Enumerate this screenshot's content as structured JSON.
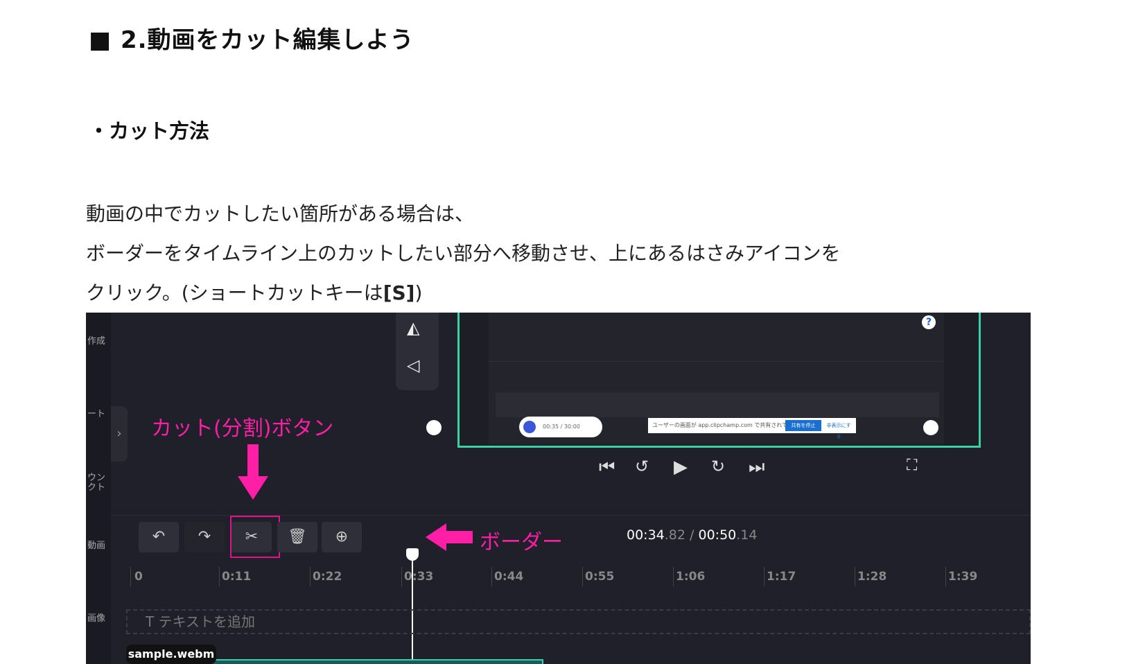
{
  "heading": "■ 2.動画をカット編集しよう",
  "subheading": "・カット方法",
  "paragraph": {
    "line1": "動画の中でカットしたい箇所がある場合は、",
    "line2": "ボーダーをタイムライン上のカットしたい部分へ移動させ、上にあるはさみアイコンを",
    "line3_prefix": "クリック。(ショートカットキーは",
    "line3_key": "[S]",
    "line3_suffix": ")"
  },
  "screenshot": {
    "left_rail_labels": [
      "作成",
      "ート",
      "ウン\nクト",
      "動画",
      "画像"
    ],
    "annotations": {
      "cut_button": "カット(分割)ボタン",
      "border": "ボーダー"
    },
    "toolbar_icons": [
      "undo-icon",
      "redo-icon",
      "scissors-icon",
      "trash-icon",
      "add-media-icon"
    ],
    "time_current": "00:34",
    "time_current_frac": ".82",
    "time_sep": "/",
    "time_total": "00:50",
    "time_total_frac": ".14",
    "ruler_labels": [
      "0",
      "0:11",
      "0:22",
      "0:33",
      "0:44",
      "0:55",
      "1:06",
      "1:17",
      "1:28",
      "1:39"
    ],
    "text_track_placeholder": "T  テキストを追加",
    "clip_name": "sample.webm",
    "preview": {
      "notice_text": "ユーザーの画面が app.clipchamp.com で共有されています。",
      "notice_stop": "共有を停止",
      "notice_hide": "非表示にする",
      "rec_time": "00:35 / 30:00",
      "help": "?"
    },
    "colors": {
      "accent_green": "#39d1a6",
      "annotation_pink": "#ff1fa6"
    }
  }
}
